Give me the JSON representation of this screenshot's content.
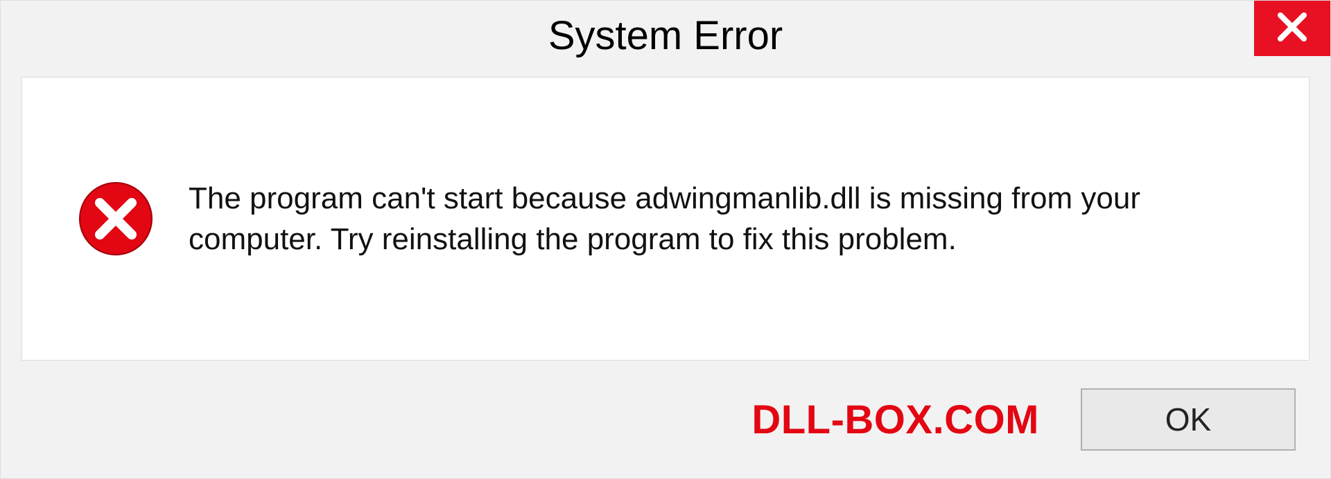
{
  "dialog": {
    "title": "System Error",
    "message": "The program can't start because adwingmanlib.dll is missing from your computer. Try reinstalling the program to fix this problem.",
    "ok_label": "OK"
  },
  "watermark": "DLL-BOX.COM",
  "colors": {
    "close_button_bg": "#e81123",
    "error_icon_bg": "#e30613",
    "watermark_text": "#e30613"
  }
}
